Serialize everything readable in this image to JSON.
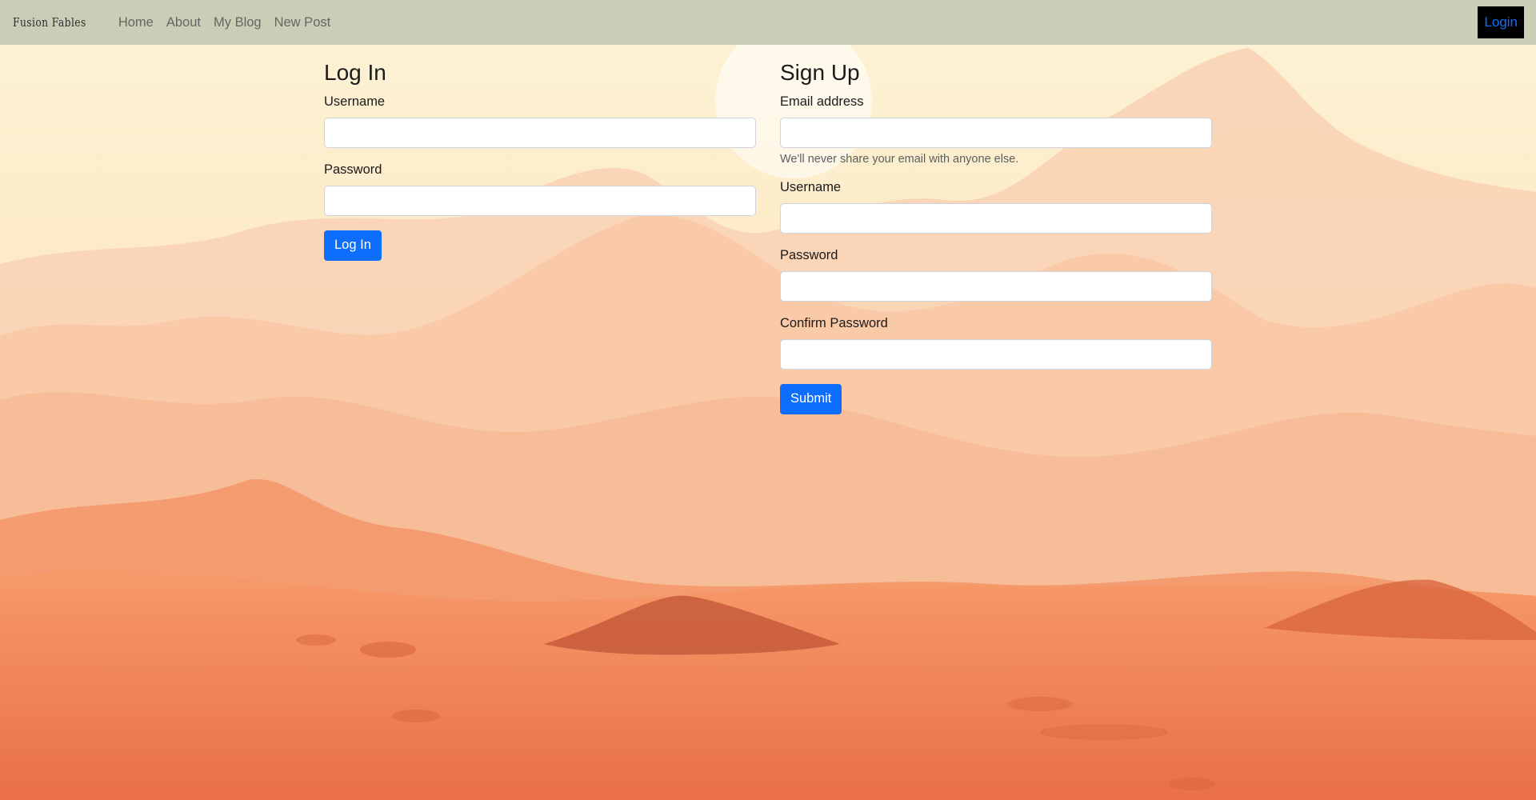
{
  "navbar": {
    "brand": "Fusion Fables",
    "links": [
      "Home",
      "About",
      "My Blog",
      "New Post"
    ],
    "login_label": "Login"
  },
  "login_form": {
    "title": "Log In",
    "username_label": "Username",
    "password_label": "Password",
    "submit_label": "Log In"
  },
  "signup_form": {
    "title": "Sign Up",
    "email_label": "Email address",
    "email_help": "We'll never share your email with anyone else.",
    "username_label": "Username",
    "password_label": "Password",
    "confirm_password_label": "Confirm Password",
    "submit_label": "Submit"
  },
  "colors": {
    "primary": "#0d6efd",
    "navbar_bg": "#c8cab4",
    "login_button_bg": "#000000",
    "sky": "#fdf5d8",
    "desert_far": "#f7c2a2",
    "desert_near": "#ee7a4c"
  },
  "icons": {
    "background": "desert-landscape-illustration"
  }
}
